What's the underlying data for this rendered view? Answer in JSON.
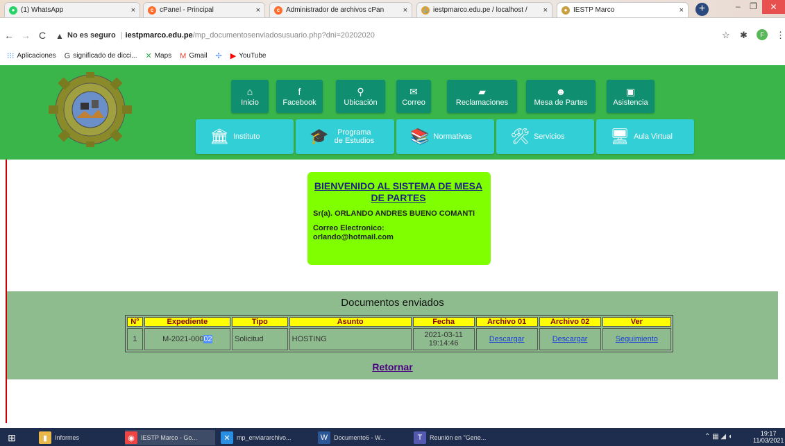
{
  "browser": {
    "tabs": [
      {
        "label": "(1) WhatsApp",
        "icon": "whatsapp-icon",
        "color": "#25d366",
        "glyph": "●"
      },
      {
        "label": "cPanel - Principal",
        "icon": "cpanel-icon",
        "color": "#ff6c2c",
        "glyph": "c"
      },
      {
        "label": "Administrador de archivos cPan",
        "icon": "cpanel-icon",
        "color": "#ff6c2c",
        "glyph": "c"
      },
      {
        "label": "iestpmarco.edu.pe / localhost /",
        "icon": "phpmyadmin-icon",
        "color": "#e0a030",
        "glyph": "⚓"
      },
      {
        "label": "IESTP Marco",
        "icon": "site-icon",
        "color": "#c8a040",
        "glyph": "●"
      }
    ],
    "url": {
      "warning": "No es seguro",
      "host": "iestpmarco.edu.pe",
      "path": "/mp_documentosenviadosusuario.php?dni=20202020"
    },
    "profile_initial": "F",
    "bookmarks": [
      {
        "label": "Aplicaciones",
        "icon": "apps-icon",
        "glyph": "⁝⁝⁝",
        "color": "#4285f4"
      },
      {
        "label": "significado de dicci...",
        "icon": "google-icon",
        "glyph": "G",
        "color": "#333"
      },
      {
        "label": "Maps",
        "icon": "maps-icon",
        "glyph": "✕",
        "color": "#34a853"
      },
      {
        "label": "Gmail",
        "icon": "gmail-icon",
        "glyph": "M",
        "color": "#ea4335"
      },
      {
        "label": "",
        "icon": "translate-icon",
        "glyph": "✢",
        "color": "#4285f4"
      },
      {
        "label": "YouTube",
        "icon": "youtube-icon",
        "glyph": "▶",
        "color": "#ff0000"
      }
    ]
  },
  "header": {
    "nav": [
      {
        "label": "Inicio",
        "icon": "home-icon",
        "glyph": "⌂"
      },
      {
        "label": "Facebook",
        "icon": "facebook-icon",
        "glyph": "f"
      },
      {
        "label": "Ubicación",
        "icon": "location-icon",
        "glyph": "⚲"
      },
      {
        "label": "Correo",
        "icon": "mail-icon",
        "glyph": "✉"
      },
      {
        "label": "Reclamaciones",
        "icon": "complaints-icon",
        "glyph": "▰"
      },
      {
        "label": "Mesa de Partes",
        "icon": "desk-icon",
        "glyph": "☻"
      },
      {
        "label": "Asistencia",
        "icon": "attendance-icon",
        "glyph": "▣"
      }
    ],
    "sub": [
      {
        "label": "Instituto",
        "icon": "building-icon",
        "glyph": "🏛"
      },
      {
        "label": "Programa de Estudios",
        "icon": "graduate-icon",
        "glyph": "🎓"
      },
      {
        "label": "Normativas",
        "icon": "books-icon",
        "glyph": "📚"
      },
      {
        "label": "Servicios",
        "icon": "tools-icon",
        "glyph": "🛠"
      },
      {
        "label": "Aula Virtual",
        "icon": "computer-icon",
        "glyph": "🖥"
      }
    ]
  },
  "welcome": {
    "title": "BIENVENIDO AL SISTEMA DE MESA DE PARTES",
    "name": "Sr(a). ORLANDO ANDRES BUENO COMANTI",
    "email_label": "Correo Electronico:",
    "email": "orlando@hotmail.com"
  },
  "documents": {
    "title": "Documentos enviados",
    "headers": [
      "N°",
      "Expediente",
      "Tipo",
      "Asunto",
      "Fecha",
      "Archivo 01",
      "Archivo 02",
      "Ver"
    ],
    "rows": [
      {
        "n": "1",
        "expediente_prefix": "M-2021-000",
        "expediente_selected": "02",
        "tipo": "Solicitud",
        "asunto": "HOSTING",
        "fecha_date": "2021-03-11",
        "fecha_time": "19:14:46",
        "archivo01": "Descargar",
        "archivo02": "Descargar",
        "ver": "Seguimiento"
      }
    ],
    "back_link": "Retornar"
  },
  "taskbar": {
    "items": [
      {
        "label": "Informes",
        "icon": "folder-icon",
        "glyph": "▮",
        "color": "#e8b84a"
      },
      {
        "label": "IESTP Marco - Go...",
        "icon": "chrome-icon",
        "glyph": "◉",
        "color": "#e44"
      },
      {
        "label": "mp_enviararchivo...",
        "icon": "vscode-icon",
        "glyph": "✕",
        "color": "#2a8fe0"
      },
      {
        "label": "Documento6 - W...",
        "icon": "word-icon",
        "glyph": "W",
        "color": "#2b5797"
      },
      {
        "label": "Reunión en \"Gene...",
        "icon": "teams-icon",
        "glyph": "T",
        "color": "#5558af"
      }
    ],
    "time": "19:17",
    "date": "11/03/2021"
  }
}
